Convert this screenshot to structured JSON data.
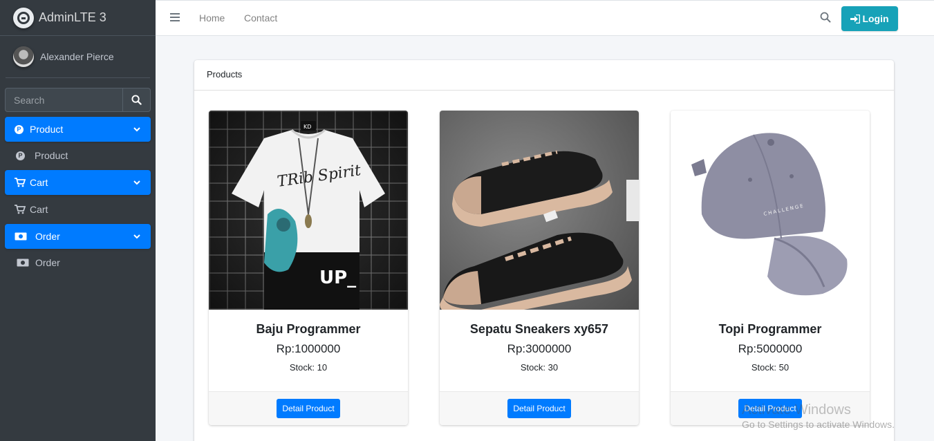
{
  "brand": {
    "title": "AdminLTE 3",
    "logo_icon": "adminlte-logo-icon"
  },
  "user": {
    "name": "Alexander Pierce"
  },
  "sidebar_search": {
    "placeholder": "Search"
  },
  "sidebar": {
    "items": [
      {
        "label": "Product",
        "icon": "product-coin-icon",
        "active": true
      },
      {
        "label": "Product",
        "icon": "product-coin-icon",
        "active": false
      },
      {
        "label": "Cart",
        "icon": "cart-icon",
        "active": true
      },
      {
        "label": "Cart",
        "icon": "cart-icon",
        "active": false
      },
      {
        "label": "Order",
        "icon": "money-bill-icon",
        "active": true
      },
      {
        "label": "Order",
        "icon": "money-bill-icon",
        "active": false
      }
    ]
  },
  "navbar": {
    "links": [
      "Home",
      "Contact"
    ],
    "login_label": "Login"
  },
  "card": {
    "title": "Products"
  },
  "products": [
    {
      "name": "Baju Programmer",
      "price": "Rp:1000000",
      "stock": "Stock: 10",
      "button": "Detail Product"
    },
    {
      "name": "Sepatu Sneakers xy657",
      "price": "Rp:3000000",
      "stock": "Stock: 30",
      "button": "Detail Product"
    },
    {
      "name": "Topi Programmer",
      "price": "Rp:5000000",
      "stock": "Stock: 50",
      "button": "Detail Product"
    }
  ],
  "watermark": {
    "title": "Activate Windows",
    "subtitle": "Go to Settings to activate Windows."
  },
  "colors": {
    "primary": "#007bff",
    "info": "#17a2b8",
    "sidebar": "#343a40"
  }
}
